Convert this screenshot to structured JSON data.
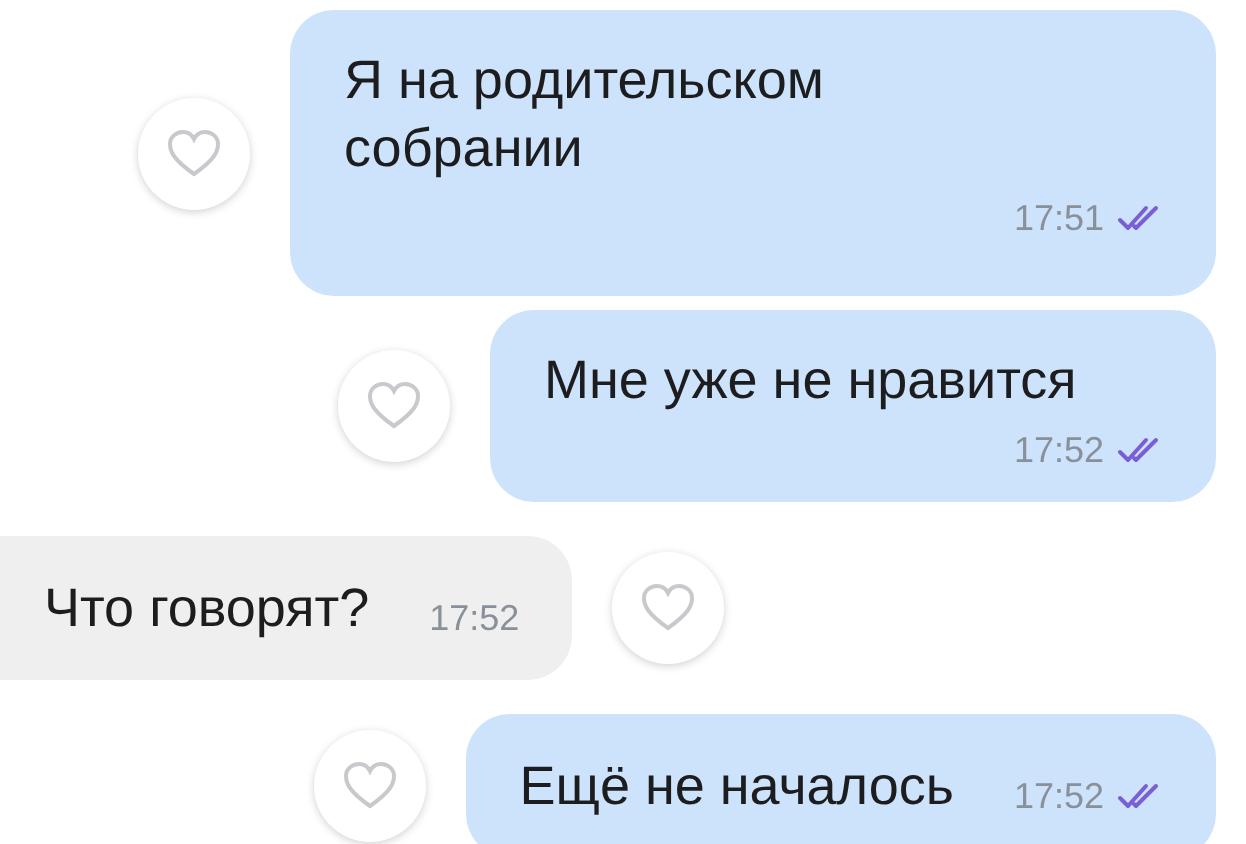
{
  "messages": [
    {
      "outgoing": true,
      "kind": "stacked",
      "text": "Я на родительском собрании",
      "time": "17:51",
      "read": true,
      "liked": false
    },
    {
      "outgoing": true,
      "kind": "stacked",
      "text": "Мне уже не нравится",
      "time": "17:52",
      "read": true,
      "liked": false
    },
    {
      "outgoing": false,
      "kind": "inline",
      "text": "Что говорят?",
      "time": "17:52",
      "liked": false
    },
    {
      "outgoing": true,
      "kind": "inline",
      "text": "Ещё не началось",
      "time": "17:52",
      "read": true,
      "liked": false
    }
  ]
}
